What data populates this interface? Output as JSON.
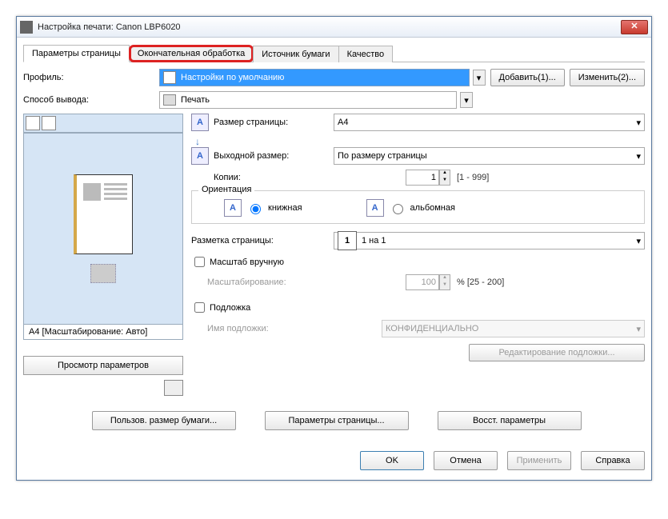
{
  "window": {
    "title": "Настройка печати: Canon LBP6020"
  },
  "tabs": {
    "page_params": "Параметры страницы",
    "finishing": "Окончательная обработка",
    "paper_source": "Источник бумаги",
    "quality": "Качество"
  },
  "profile": {
    "label": "Профиль:",
    "value": "Настройки по умолчанию",
    "add_btn": "Добавить(1)...",
    "edit_btn": "Изменить(2)..."
  },
  "output": {
    "label": "Способ вывода:",
    "value": "Печать"
  },
  "preview": {
    "status": "A4 [Масштабирование: Авто]",
    "view_btn": "Просмотр параметров"
  },
  "page_size": {
    "label": "Размер страницы:",
    "value": "A4"
  },
  "output_size": {
    "label": "Выходной размер:",
    "value": "По размеру страницы"
  },
  "copies": {
    "label": "Копии:",
    "value": "1",
    "range": "[1 - 999]"
  },
  "orientation": {
    "legend": "Ориентация",
    "portrait": "книжная",
    "landscape": "альбомная"
  },
  "layout": {
    "label": "Разметка страницы:",
    "icon_text": "1",
    "value": "1 на 1"
  },
  "manual_scale": {
    "checkbox": "Масштаб вручную",
    "scaling_label": "Масштабирование:",
    "value": "100",
    "range": "% [25 - 200]"
  },
  "underlay": {
    "checkbox": "Подложка",
    "name_label": "Имя подложки:",
    "value": "КОНФИДЕНЦИАЛЬНО",
    "edit_btn": "Редактирование подложки..."
  },
  "bottom": {
    "custom_size": "Пользов. размер бумаги...",
    "page_params": "Параметры страницы...",
    "restore": "Восст. параметры"
  },
  "dialog": {
    "ok": "OK",
    "cancel": "Отмена",
    "apply": "Применить",
    "help": "Справка"
  }
}
